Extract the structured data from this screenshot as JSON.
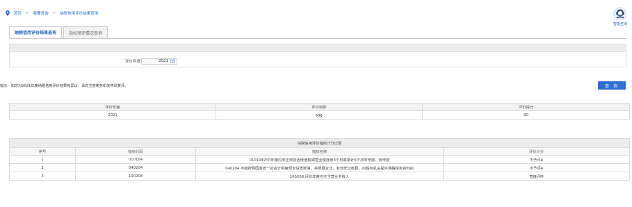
{
  "breadcrumb": {
    "home": "首页",
    "query": "我要查询",
    "current": "纳税信用评价结果查询",
    "separator": ">"
  },
  "assistant": {
    "label": "智能咨询"
  },
  "tabs": [
    {
      "label": "纳税信用评价结果查询"
    },
    {
      "label": "指标预评情况查询"
    }
  ],
  "filter": {
    "year_label": "评价年度",
    "year_value": "2021"
  },
  "hint": "提示：如您对2021年度纳税信用评价结果有异议，请向主管税务机关申请复评。",
  "query_button": "查 询",
  "result_table": {
    "headers": [
      "评价年度",
      "评价级别",
      "评价得分"
    ],
    "row": [
      "2021",
      "M级",
      "90"
    ]
  },
  "detail_table": {
    "caption": "纳税信用评价指标计分记录",
    "headers": [
      "序号",
      "指标代码",
      "指标名称",
      "评价计分"
    ],
    "rows": [
      [
        "1",
        "010104",
        "010104评价年度内非正常原因增值税或营业税连续3个月或累计6个月零申报、负申报",
        "不予评A"
      ],
      [
        "2",
        "040204",
        "040204.不能按照国家统一的会计制度规定设置账簿，并根据合法、有效凭证核算，向税务机关提供准确税务资料的",
        "不予评A"
      ],
      [
        "3",
        "100208",
        "100208.评价年度内无主营业务收入",
        "直接评M"
      ]
    ]
  }
}
